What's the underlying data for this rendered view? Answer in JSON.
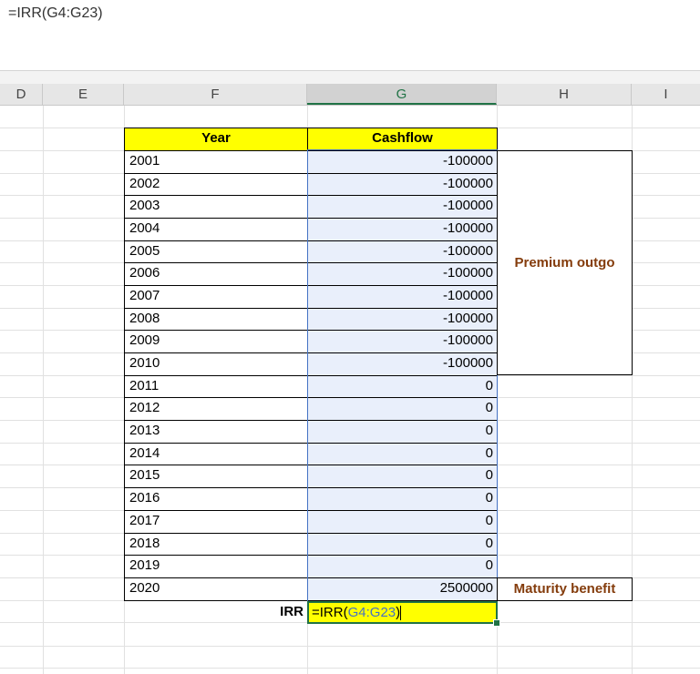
{
  "formula_bar": {
    "text": "=IRR(G4:G23)"
  },
  "columns": [
    {
      "id": "D",
      "label": "D"
    },
    {
      "id": "E",
      "label": "E"
    },
    {
      "id": "F",
      "label": "F"
    },
    {
      "id": "G",
      "label": "G"
    },
    {
      "id": "H",
      "label": "H"
    },
    {
      "id": "I",
      "label": "I"
    }
  ],
  "table": {
    "year_header": "Year",
    "cashflow_header": "Cashflow",
    "rows": [
      {
        "year": "2001",
        "cashflow": "-100000"
      },
      {
        "year": "2002",
        "cashflow": "-100000"
      },
      {
        "year": "2003",
        "cashflow": "-100000"
      },
      {
        "year": "2004",
        "cashflow": "-100000"
      },
      {
        "year": "2005",
        "cashflow": "-100000"
      },
      {
        "year": "2006",
        "cashflow": "-100000"
      },
      {
        "year": "2007",
        "cashflow": "-100000"
      },
      {
        "year": "2008",
        "cashflow": "-100000"
      },
      {
        "year": "2009",
        "cashflow": "-100000"
      },
      {
        "year": "2010",
        "cashflow": "-100000"
      },
      {
        "year": "2011",
        "cashflow": "0"
      },
      {
        "year": "2012",
        "cashflow": "0"
      },
      {
        "year": "2013",
        "cashflow": "0"
      },
      {
        "year": "2014",
        "cashflow": "0"
      },
      {
        "year": "2015",
        "cashflow": "0"
      },
      {
        "year": "2016",
        "cashflow": "0"
      },
      {
        "year": "2017",
        "cashflow": "0"
      },
      {
        "year": "2018",
        "cashflow": "0"
      },
      {
        "year": "2019",
        "cashflow": "0"
      },
      {
        "year": "2020",
        "cashflow": "2500000"
      }
    ]
  },
  "annotations": {
    "premium_outgo": "Premium outgo",
    "maturity_benefit": "Maturity benefit"
  },
  "irr": {
    "label": "IRR",
    "formula_prefix": "=IRR(",
    "formula_ref": "G4:G23",
    "formula_suffix": ")"
  },
  "colors": {
    "header_fill": "#ffff00",
    "cashflow_fill": "#e9effb",
    "annotation_text": "#843c0c",
    "selection": "#4472c4",
    "active_cell_border": "#217346"
  }
}
